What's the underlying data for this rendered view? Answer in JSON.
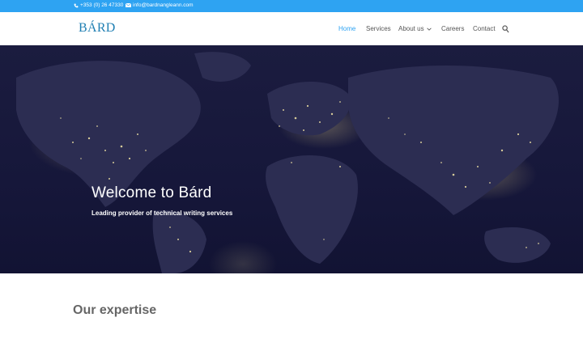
{
  "topbar": {
    "phone": "+353 (0) 26 47330",
    "email": "info@bardnangleann.com"
  },
  "header": {
    "logo": "BÁRD",
    "nav": {
      "home": "Home",
      "services": "Services",
      "about": "About us",
      "careers": "Careers",
      "contact": "Contact"
    }
  },
  "hero": {
    "title": "Welcome to Bárd",
    "subtitle": "Leading provider of technical writing services"
  },
  "section": {
    "title": "Our expertise"
  },
  "colors": {
    "accent": "#2ea3f2",
    "logo": "#1f7fb3",
    "nav_text": "#555555",
    "hero_bg": "#16173a"
  },
  "icons": {
    "phone": "phone-icon",
    "email": "envelope-icon",
    "search": "search-icon",
    "about_dropdown": "chevron-down-icon"
  }
}
